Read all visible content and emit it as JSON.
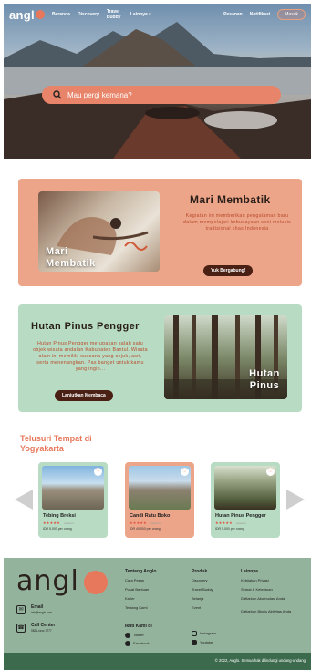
{
  "nav": {
    "logo_text": "angl",
    "links": [
      "Beranda",
      "Discovery",
      "Travel Buddy",
      "Lainnya ▾"
    ],
    "right_links": [
      "Pesanan",
      "Notifikasi"
    ],
    "login_label": "Masuk"
  },
  "search": {
    "placeholder": "Mau pergi kemana?"
  },
  "feature1": {
    "photo_label": "Mari Membatik",
    "title": "Mari Membatik",
    "description": "Kegiatan ini memberikan pengalaman baru dalam mempelajari kebudayaan seni melukis tradisional khas Indonesia",
    "button": "Yuk Bergabung!"
  },
  "feature2": {
    "title": "Hutan Pinus Pengger",
    "description": "Hutan Pinus Pengger merupakan salah satu objek wisata andalan Kabupaten Bantul. Wisata alam ini memiliki suasana yang sejuk, asri, serta menenangkan. Pas banget untuk kamu yang ingin...",
    "button": "Lanjutkan Membaca",
    "photo_label": "Hutan Pinus"
  },
  "explore": {
    "title": "Telusuri Tempat di Yogyakarta",
    "places": [
      {
        "name": "Tebing Breksi",
        "stars": "★★★★★",
        "reviews": "(ulasan)",
        "price": "IDR 5.000 per orang"
      },
      {
        "name": "Candi Ratu Boko",
        "stars": "★★★★★",
        "reviews": "(ulasan)",
        "price": "IDR 40.000 per orang"
      },
      {
        "name": "Hutan Pinus Pengger",
        "stars": "★★★★★",
        "reviews": "(ulasan)",
        "price": "IDR 5.000 per orang"
      }
    ]
  },
  "footer": {
    "logo_text": "angl",
    "email_label": "Email",
    "email_value": "info@anglo.com",
    "callcenter_label": "Call Center",
    "callcenter_value": "0821-xxxx-7777",
    "col1_title": "Tentang Anglo",
    "col1_items": [
      "Cara Pesan",
      "Pusat Bantuan",
      "Karier",
      "Tentang Kami"
    ],
    "col2_title": "Produk",
    "col2_items": [
      "Discovery",
      "Travel Buddy",
      "Belanja",
      "Event"
    ],
    "col3_title": "Lainnya",
    "col3_items": [
      "Kebijakan Privasi",
      "Syarat & Ketentuan",
      "Daftarkan Akomodasi Anda",
      "Daftarkan Bisnis Aktivitas Anda"
    ],
    "follow_title": "Ikuti Kami di",
    "social_left": [
      "Twitter",
      "Facebook"
    ],
    "social_right": [
      "Instagram",
      "Youtube"
    ],
    "copyright": "© 2022, Anglo. Semua hak dilindungi undang-undang"
  },
  "colors": {
    "accent": "#e7785b",
    "orange_card": "#eda58a",
    "green_card": "#b8dcc3",
    "footer": "#94b39c",
    "footer_bar": "#3c6a4d"
  }
}
